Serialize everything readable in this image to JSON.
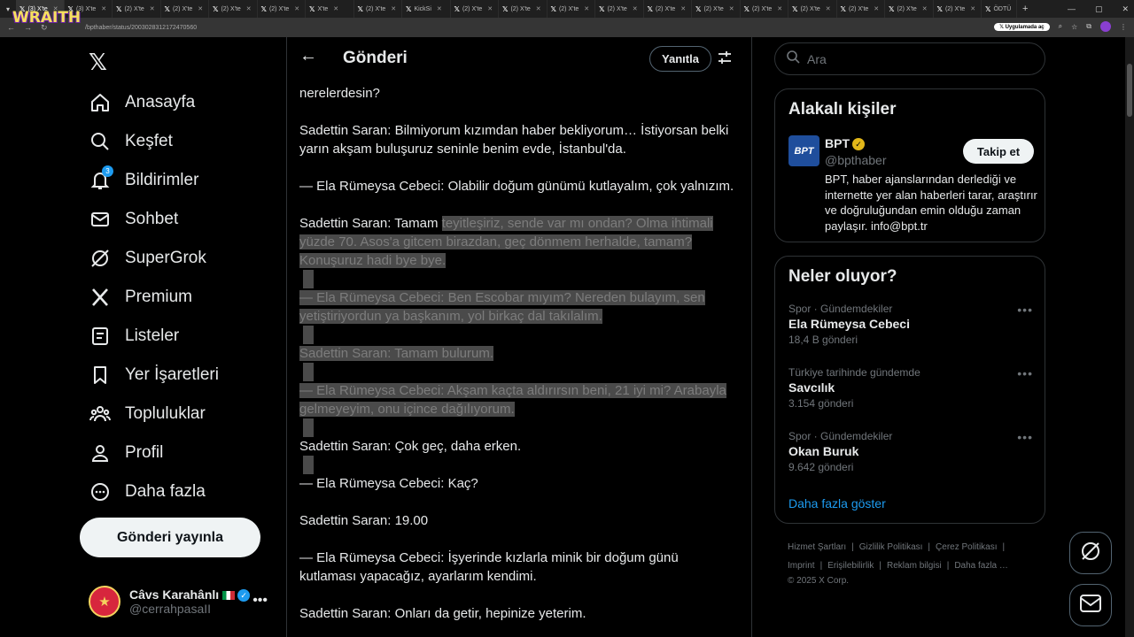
{
  "overlay_logo": "WRAITH",
  "browser": {
    "tabs": [
      {
        "label": "(3) X'te",
        "active": true
      },
      {
        "label": "(3) X'te"
      },
      {
        "label": "(2) X'te"
      },
      {
        "label": "(2) X'te"
      },
      {
        "label": "(2) X'te"
      },
      {
        "label": "(2) X'te"
      },
      {
        "label": "X'te"
      },
      {
        "label": "(2) X'te"
      },
      {
        "label": "KickSi"
      },
      {
        "label": "(2) X'te"
      },
      {
        "label": "(2) X'te"
      },
      {
        "label": "(2) X'te"
      },
      {
        "label": "(2) X'te"
      },
      {
        "label": "(2) X'te"
      },
      {
        "label": "(2) X'te"
      },
      {
        "label": "(2) X'te"
      },
      {
        "label": "(2) X'te"
      },
      {
        "label": "(2) X'te"
      },
      {
        "label": "(2) X'te"
      },
      {
        "label": "(2) X'te"
      },
      {
        "label": "ÖDTÜ"
      }
    ],
    "url": "/bpthaber/status/2003028312172470560",
    "open_in_app": "Uygulamada aç"
  },
  "nav": {
    "items": [
      {
        "label": "Anasayfa",
        "icon": "home-icon"
      },
      {
        "label": "Keşfet",
        "icon": "search-icon"
      },
      {
        "label": "Bildirimler",
        "icon": "bell-icon",
        "badge": "3"
      },
      {
        "label": "Sohbet",
        "icon": "mail-icon"
      },
      {
        "label": "SuperGrok",
        "icon": "grok-icon"
      },
      {
        "label": "Premium",
        "icon": "x-logo-icon"
      },
      {
        "label": "Listeler",
        "icon": "list-icon"
      },
      {
        "label": "Yer İşaretleri",
        "icon": "bookmark-icon"
      },
      {
        "label": "Topluluklar",
        "icon": "communities-icon"
      },
      {
        "label": "Profil",
        "icon": "profile-icon"
      },
      {
        "label": "Daha fazla",
        "icon": "more-circle-icon"
      }
    ],
    "post_button": "Gönderi yayınla",
    "account": {
      "name": "Câvs Karahânlı",
      "handle": "@cerrahpasaII"
    }
  },
  "header": {
    "title": "Gönderi",
    "reply_button": "Yanıtla"
  },
  "tweet": {
    "paragraphs": [
      {
        "text": "nerelerdesin?"
      },
      {
        "text": "Sadettin Saran: Bilmiyorum kızımdan haber bekliyorum… İstiyorsan belki yarın akşam buluşuruz seninle benim evde, İstanbul'da."
      },
      {
        "text": "— Ela Rümeysa Cebeci: Olabilir doğum günümü kutlayalım, çok yalnızım."
      },
      {
        "text": "Sadettin Saran: Tamam ",
        "highlighted": "teyitleşiriz, sende var mı ondan? Olma ihtimali yüzde 70. Asos'a gitcem birazdan, geç dönmem herhalde, tamam? Konuşuruz hadi bye bye."
      },
      {
        "highlighted": "— Ela Rümeysa Cebeci: Ben Escobar mıyım? Nereden bulayım, sen yetiştiriyordun ya başkanım, yol birkaç dal takılalım."
      },
      {
        "highlighted": "Sadettin Saran: Tamam bulurum."
      },
      {
        "highlighted": "— Ela Rümeysa Cebeci: Akşam kaçta aldırırsın beni, 21 iyi mi? Arabayla gelmeyeyim, onu içince dağılıyorum."
      },
      {
        "text": "Sadettin Saran: Çok geç, daha erken."
      },
      {
        "text": "— Ela Rümeysa Cebeci: Kaç?"
      },
      {
        "text": "Sadettin Saran: 19.00"
      },
      {
        "text": "— Ela Rümeysa Cebeci: İşyerinde kızlarla minik bir doğum günü kutlaması yapacağız, ayarlarım kendimi."
      },
      {
        "text": "Sadettin Saran: Onları da getir, hepinize yeterim."
      }
    ]
  },
  "search": {
    "placeholder": "Ara"
  },
  "related": {
    "title": "Alakalı kişiler",
    "logo_text": "BPT",
    "name": "BPT",
    "handle": "@bpthaber",
    "follow_label": "Takip et",
    "bio": "BPT, haber ajanslarından derlediği ve internette yer alan haberleri tarar, araştırır ve doğruluğundan emin olduğu zaman paylaşır. info@bpt.tr"
  },
  "trends": {
    "title": "Neler oluyor?",
    "items": [
      {
        "meta": "Spor · Gündemdekiler",
        "title": "Ela Rümeysa Cebeci",
        "count": "18,4 B gönderi"
      },
      {
        "meta": "Türkiye tarihinde gündemde",
        "title": "Savcılık",
        "count": "3.154 gönderi"
      },
      {
        "meta": "Spor · Gündemdekiler",
        "title": "Okan Buruk",
        "count": "9.642 gönderi"
      }
    ],
    "show_more": "Daha fazla göster"
  },
  "footer": {
    "links": [
      "Hizmet Şartları",
      "Gizlilik Politikası",
      "Çerez Politikası",
      "Imprint",
      "Erişilebilirlik",
      "Reklam bilgisi",
      "Daha fazla …"
    ],
    "copyright": "© 2025 X Corp."
  },
  "colors": {
    "accent": "#1d9bf0",
    "highlight": "#4a4a4a",
    "border": "#2f3336",
    "verified_gold": "#e2b719"
  }
}
